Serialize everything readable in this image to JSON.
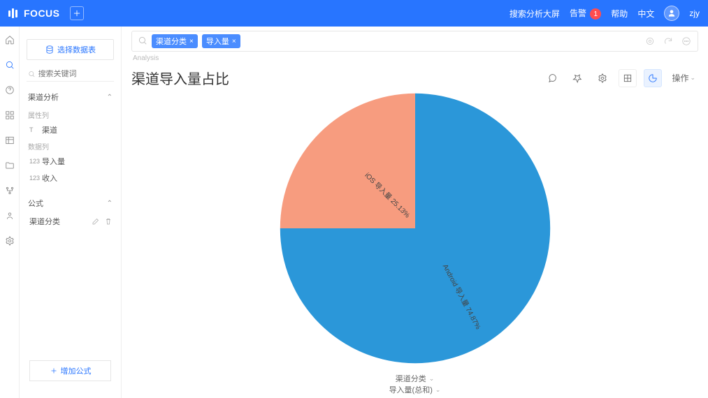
{
  "topbar": {
    "brand": "FOCUS",
    "links": {
      "search_screen": "搜索分析大屏",
      "alerts": "告警",
      "alerts_count": "1",
      "help": "帮助",
      "lang": "中文",
      "user": "zjy"
    }
  },
  "sidebar": {
    "select_ds": "选择数据表",
    "search_placeholder": "搜索关键词",
    "section_analysis": "渠道分析",
    "group_attr": "属性列",
    "col_channel": "渠道",
    "group_metric": "数据列",
    "col_import": "导入量",
    "col_income": "收入",
    "section_formula": "公式",
    "formula_item": "渠道分类",
    "add_formula": "增加公式"
  },
  "query": {
    "chips": [
      "渠道分类",
      "导入量"
    ],
    "breadcrumb": "Analysis",
    "title": "渠道导入量占比",
    "operate": "操作"
  },
  "axis": {
    "x": "渠道分类",
    "y": "导入量(总和)"
  },
  "chart_data": {
    "type": "pie",
    "title": "渠道导入量占比",
    "series": [
      {
        "name": "Android 导入量",
        "value": 74.87,
        "label": "Android 导入量 74.87%",
        "color": "#2b97d9"
      },
      {
        "name": "iOS 导入量",
        "value": 25.13,
        "label": "iOS 导入量 25.13%",
        "color": "#f79c7f"
      }
    ]
  }
}
